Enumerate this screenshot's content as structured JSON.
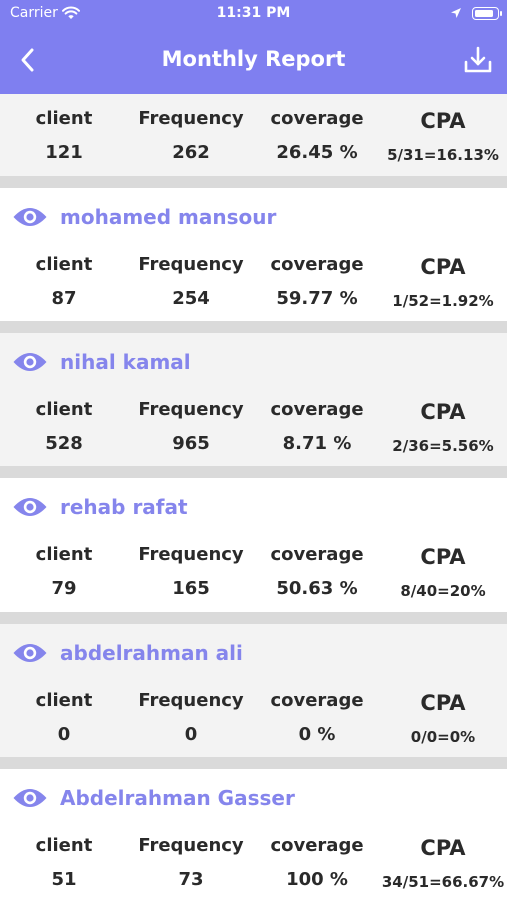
{
  "status_bar": {
    "carrier": "Carrier",
    "time": "11:31 PM",
    "battery_level": 0.9
  },
  "header": {
    "title": "Monthly Report",
    "back_icon": "chevron-left-icon",
    "action_icon": "download-icon",
    "color": "#7f7ff0"
  },
  "labels": {
    "client": "client",
    "frequency": "Frequency",
    "coverage": "coverage",
    "cpa": "CPA"
  },
  "summary": {
    "client": "121",
    "frequency": "262",
    "coverage": "26.45 %",
    "cpa": "5/31=16.13%"
  },
  "reps": [
    {
      "name": "mohamed mansour",
      "client": "87",
      "frequency": "254",
      "coverage": "59.77 %",
      "cpa": "1/52=1.92%"
    },
    {
      "name": "nihal kamal",
      "client": "528",
      "frequency": "965",
      "coverage": "8.71 %",
      "cpa": "2/36=5.56%"
    },
    {
      "name": "rehab rafat",
      "client": "79",
      "frequency": "165",
      "coverage": "50.63 %",
      "cpa": "8/40=20%"
    },
    {
      "name": "abdelrahman ali",
      "client": "0",
      "frequency": "0",
      "coverage": "0 %",
      "cpa": "0/0=0%"
    },
    {
      "name": "Abdelrahman Gasser",
      "client": "51",
      "frequency": "73",
      "coverage": "100 %",
      "cpa": "34/51=66.67%"
    }
  ]
}
